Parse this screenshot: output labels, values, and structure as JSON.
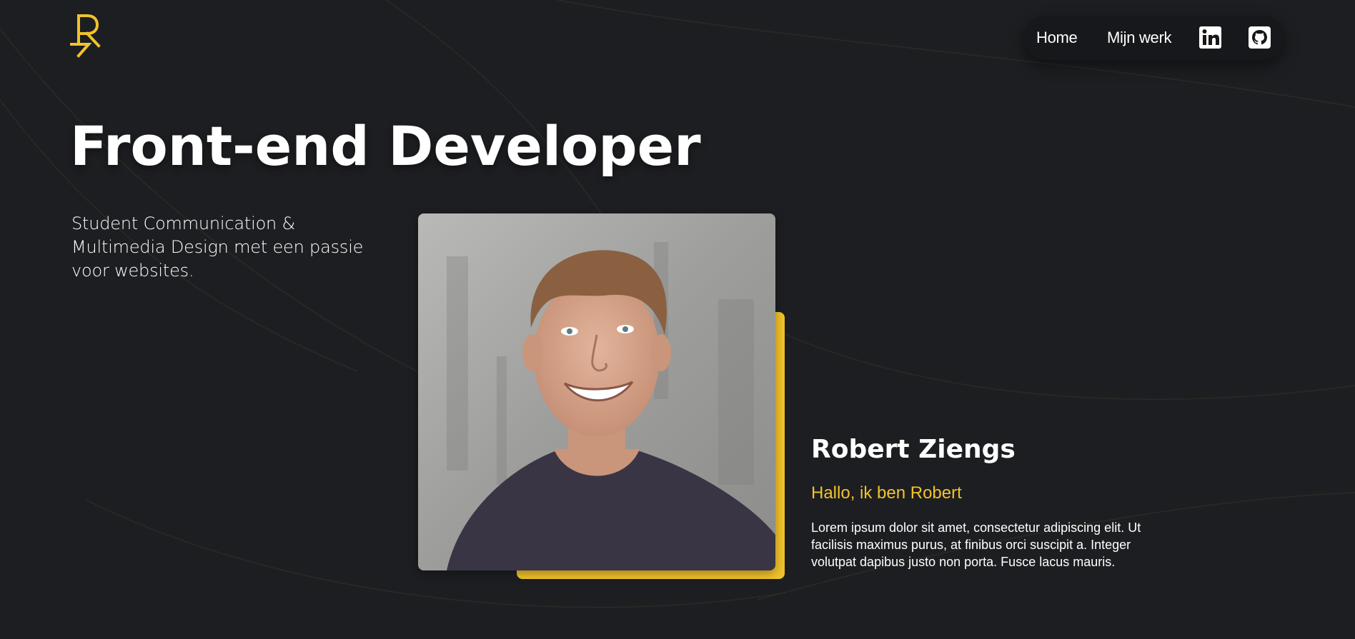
{
  "colors": {
    "background": "#1d1e21",
    "accent": "#f1c32b",
    "nav_background": "#17181b",
    "text": "#ffffff"
  },
  "header": {
    "logo_icon": "r-monogram-logo",
    "nav": {
      "items": [
        {
          "label": "Home"
        },
        {
          "label": "Mijn werk"
        }
      ],
      "icons": [
        "linkedin-icon",
        "github-icon"
      ]
    }
  },
  "hero": {
    "title": "Front-end Developer",
    "subtitle": "Student Communication & Multimedia Design met een passie voor websites."
  },
  "intro": {
    "photo": "portrait-photo",
    "name": "Robert Ziengs",
    "greeting": "Hallo, ik ben Robert",
    "body": "Lorem ipsum dolor sit amet, consectetur adipiscing elit. Ut facilisis maximus purus, at finibus orci suscipit a. Integer volutpat dapibus justo non porta. Fusce lacus mauris."
  }
}
